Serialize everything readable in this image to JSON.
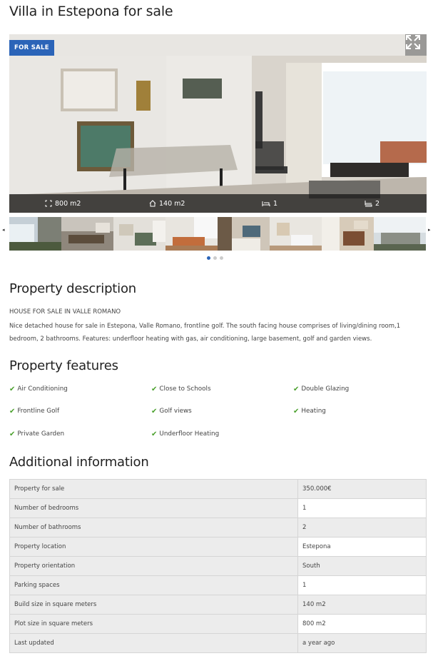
{
  "page": {
    "title": "Villa in Estepona for sale"
  },
  "hero": {
    "badge": "FOR SALE",
    "stats": [
      {
        "icon": "plot-size-icon",
        "value": "800 m2"
      },
      {
        "icon": "house-icon",
        "value": "140 m2"
      },
      {
        "icon": "bed-icon",
        "value": "1"
      },
      {
        "icon": "bath-icon",
        "value": "2"
      }
    ]
  },
  "gallery": {
    "thumb_count": 8,
    "dots": 3,
    "active_dot": 0
  },
  "description": {
    "heading": "Property description",
    "upper": "HOUSE FOR SALE IN VALLE ROMANO",
    "body": "Nice detached house for sale in Estepona, Valle Romano, frontline golf. The south facing house comprises of living/dining room,1 bedroom, 2 bathrooms. Features: underfloor heating with gas, air conditioning, large basement, golf and garden views."
  },
  "features": {
    "heading": "Property features",
    "items": [
      "Air Conditioning",
      "Close to Schools",
      "Double Glazing",
      "Frontline Golf",
      "Golf views",
      "Heating",
      "Private Garden",
      "Underfloor Heating"
    ]
  },
  "additional": {
    "heading": "Additional information",
    "rows": [
      {
        "label": "Property for sale",
        "value": "350.000€"
      },
      {
        "label": "Number of bedrooms",
        "value": "1"
      },
      {
        "label": "Number of bathrooms",
        "value": "2"
      },
      {
        "label": "Property location",
        "value": "Estepona"
      },
      {
        "label": "Property orientation",
        "value": "South"
      },
      {
        "label": "Parking spaces",
        "value": "1"
      },
      {
        "label": "Build size in square meters",
        "value": "140 m2"
      },
      {
        "label": "Plot size in square meters",
        "value": "800 m2"
      },
      {
        "label": "Last updated",
        "value": "a year ago"
      }
    ]
  },
  "colors": {
    "accent": "#2b64b8",
    "check": "#4aa02c"
  }
}
